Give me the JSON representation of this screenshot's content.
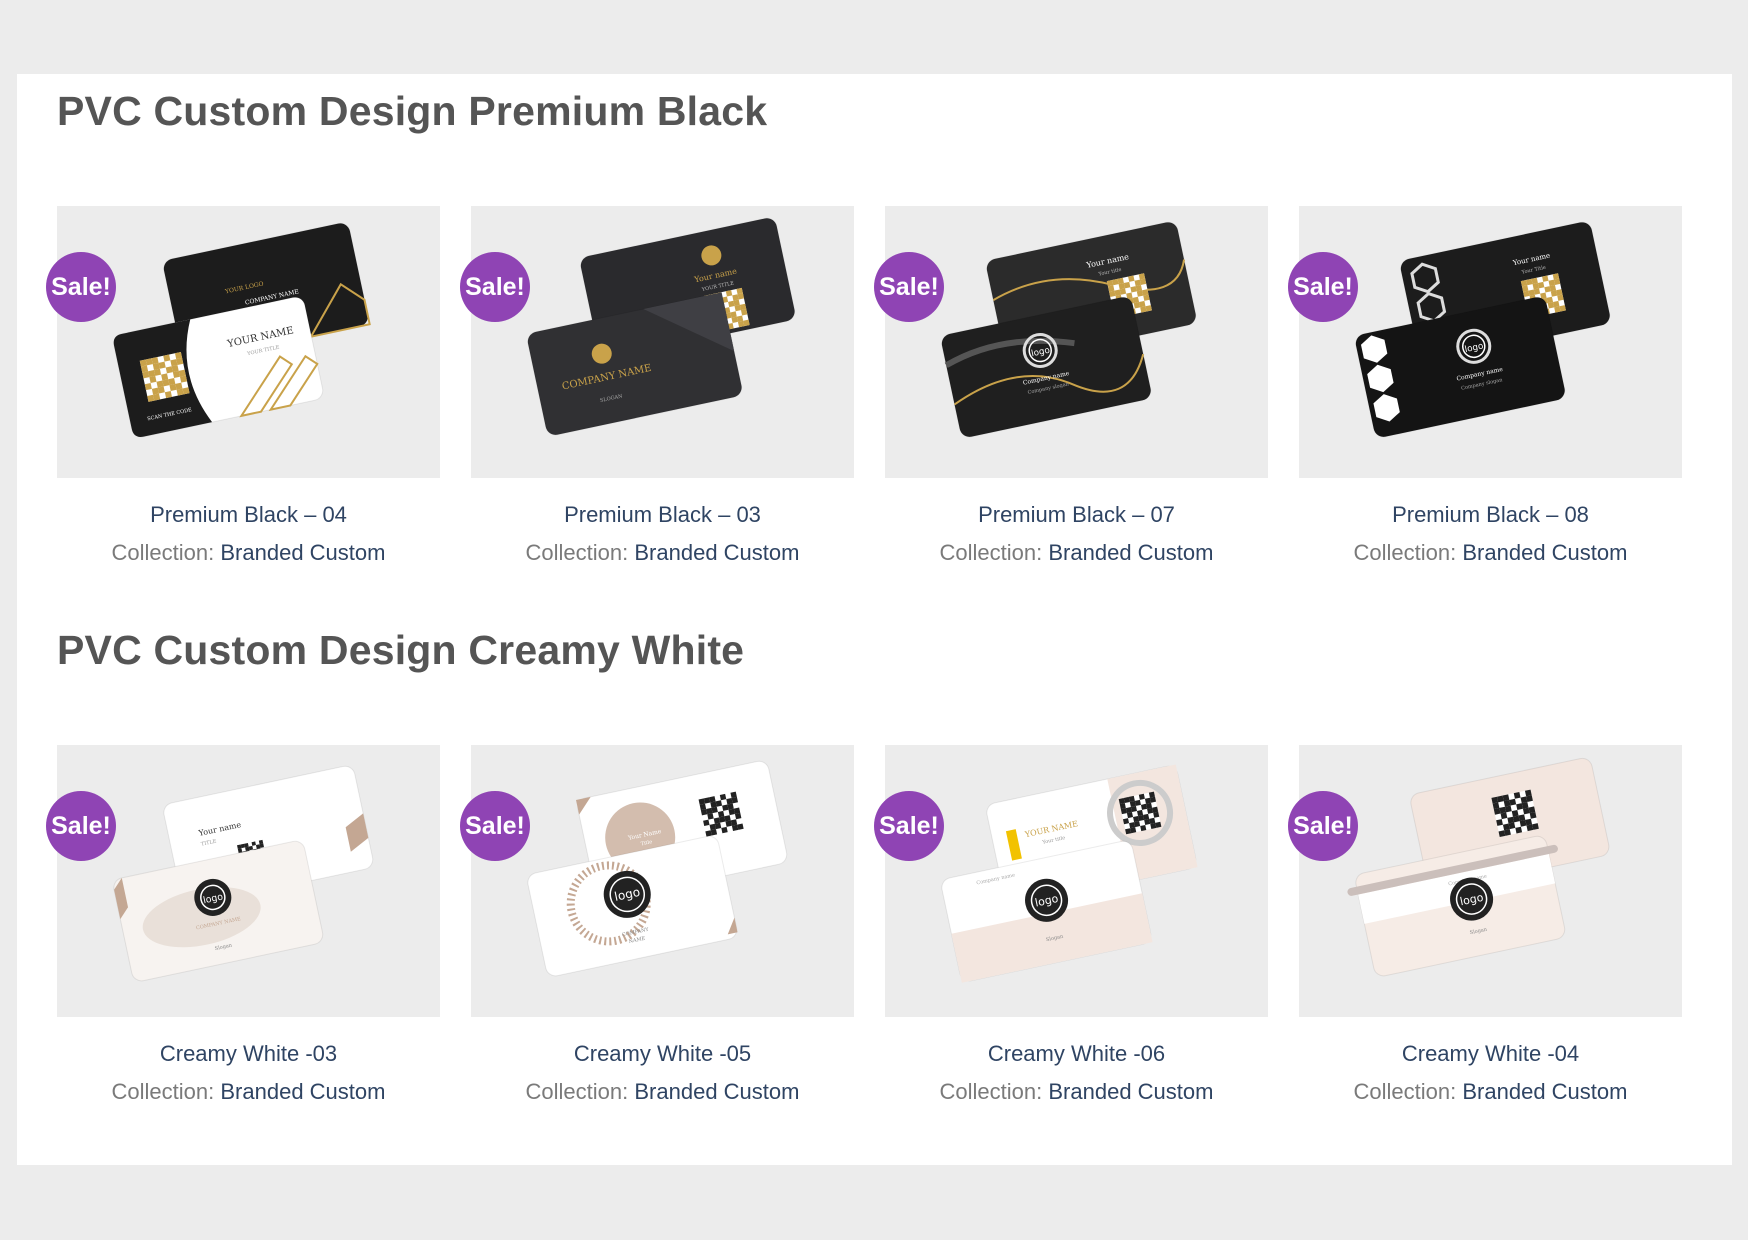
{
  "sections": [
    {
      "title": "PVC Custom Design Premium Black",
      "products": [
        {
          "badge": "Sale!",
          "title": "Premium Black – 04",
          "collection_label": "Collection:",
          "collection": "Branded Custom",
          "art": "black-gold-diagonal",
          "texts": [
            "YOUR LOGO",
            "COMPANY NAME",
            "YOUR NAME",
            "YOUR TITLE",
            "SCAN THE CODE"
          ]
        },
        {
          "badge": "Sale!",
          "title": "Premium Black – 03",
          "collection_label": "Collection:",
          "collection": "Branded Custom",
          "art": "black-shards",
          "texts": [
            "Your name",
            "YOUR TITLE",
            "COMPANY NAME",
            "SLOGAN"
          ]
        },
        {
          "badge": "Sale!",
          "title": "Premium Black – 07",
          "collection_label": "Collection:",
          "collection": "Branded Custom",
          "art": "black-marble",
          "texts": [
            "Your name",
            "Your title",
            "logo",
            "Company name",
            "Company slogan"
          ]
        },
        {
          "badge": "Sale!",
          "title": "Premium Black – 08",
          "collection_label": "Collection:",
          "collection": "Branded Custom",
          "art": "black-hexagon",
          "texts": [
            "Your name",
            "Your Title",
            "logo",
            "Company name",
            "Company slogan"
          ]
        }
      ]
    },
    {
      "title": "PVC Custom Design Creamy White",
      "products": [
        {
          "badge": "Sale!",
          "title": "Creamy White -03",
          "collection_label": "Collection:",
          "collection": "Branded Custom",
          "art": "white-map",
          "texts": [
            "Your name",
            "TITLE",
            "logo",
            "COMPANY NAME",
            "Slogan"
          ]
        },
        {
          "badge": "Sale!",
          "title": "Creamy White -05",
          "collection_label": "Collection:",
          "collection": "Branded Custom",
          "art": "white-circles",
          "texts": [
            "Your Name",
            "Title",
            "logo",
            "COMPANY",
            "NAME"
          ]
        },
        {
          "badge": "Sale!",
          "title": "Creamy White -06",
          "collection_label": "Collection:",
          "collection": "Branded Custom",
          "art": "white-yellow",
          "texts": [
            "YOUR NAME",
            "Your title",
            "Company name",
            "logo",
            "Slogan"
          ]
        },
        {
          "badge": "Sale!",
          "title": "Creamy White -04",
          "collection_label": "Collection:",
          "collection": "Branded Custom",
          "art": "white-band",
          "texts": [
            "Your name",
            "Company name",
            "logo",
            "Slogan"
          ]
        }
      ]
    }
  ],
  "colors": {
    "page_bg": "#ececec",
    "panel_bg": "#ffffff",
    "heading": "#555555",
    "link": "#2f4463",
    "muted": "#7a7a7a",
    "sale_badge": "#8f44b4",
    "gold": "#c9a24a",
    "card_black": "#1c1c1c",
    "cream": "#f3e6df",
    "beige": "#c4a793"
  }
}
